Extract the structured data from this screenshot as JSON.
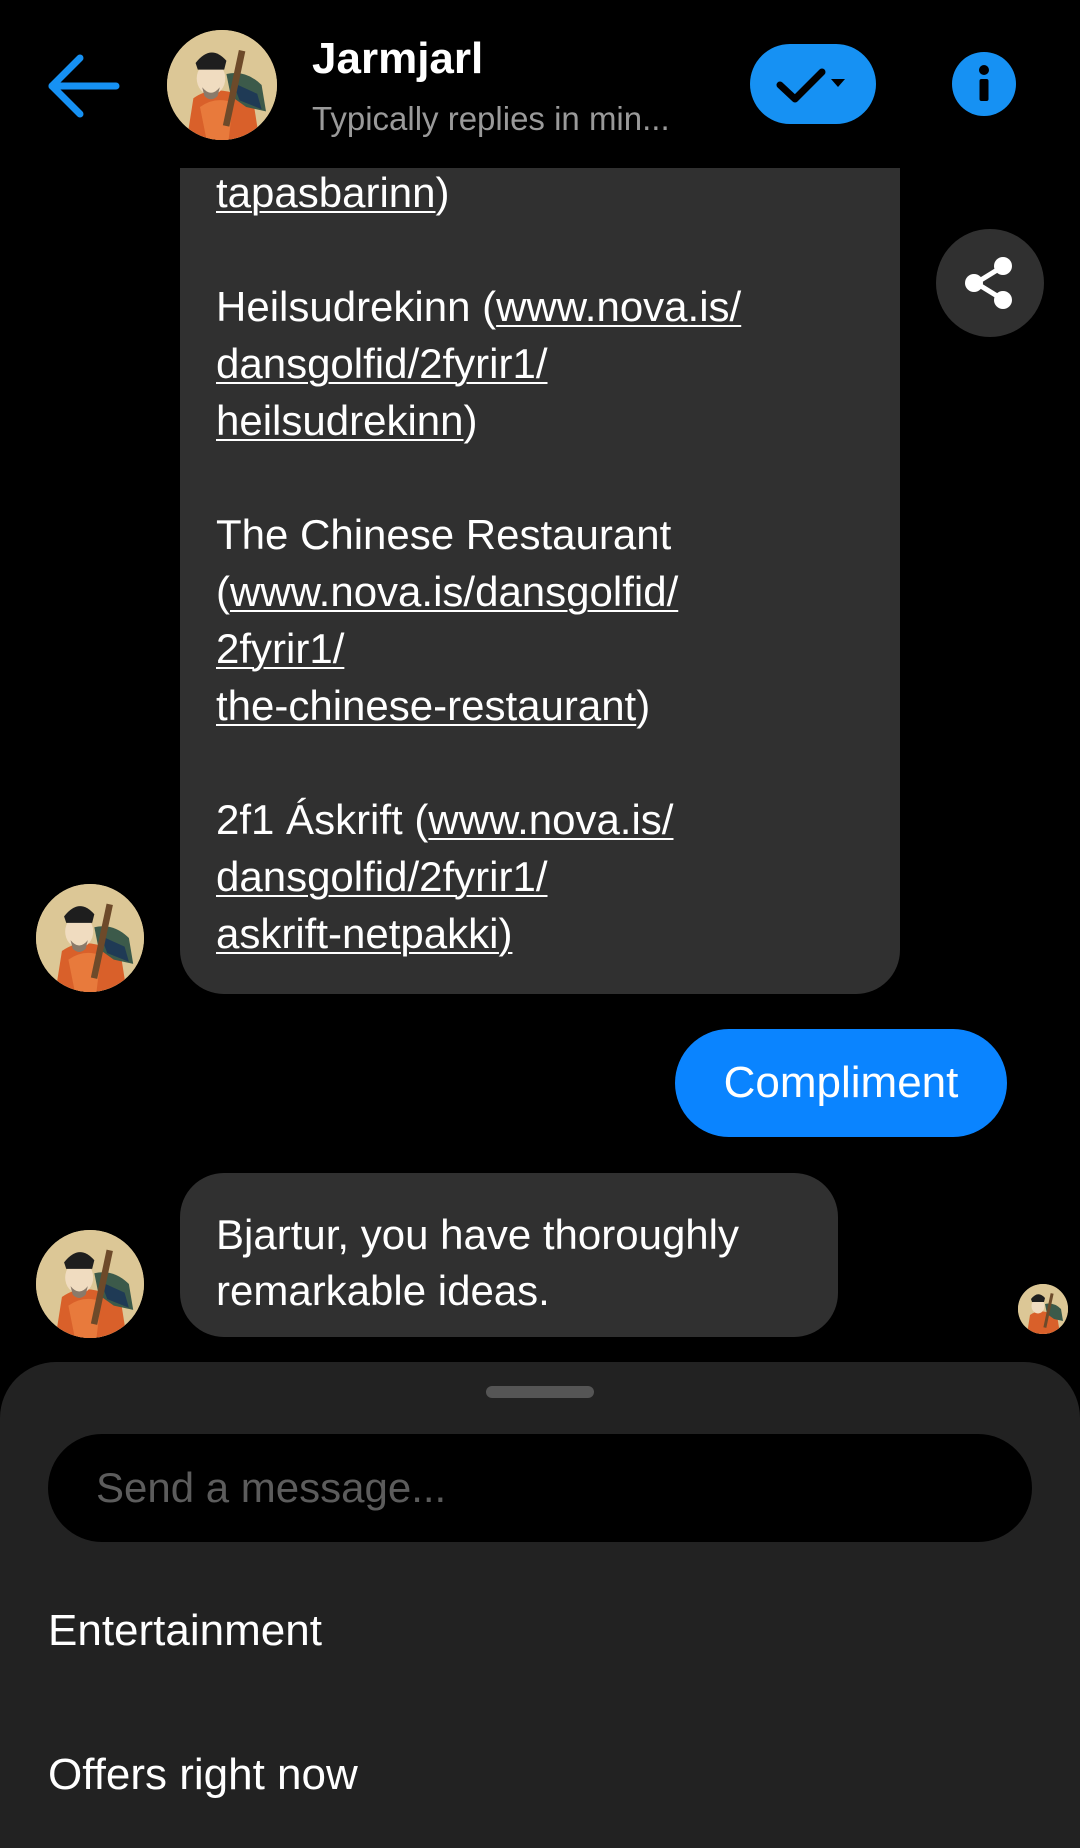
{
  "header": {
    "title": "Jarmjarl",
    "subtitle": "Typically replies in min..."
  },
  "colors": {
    "accent": "#1691f3",
    "user_bubble": "#0a84ff",
    "bot_bubble": "#303030",
    "sheet": "#222222"
  },
  "long_message": {
    "items": [
      {
        "name": "",
        "link": "tapasbarinn"
      },
      {
        "name": "Heilsudrekinn",
        "link_lines": [
          "www.nova.is/",
          "dansgolfid/2fyrir1/",
          "heilsudrekinn"
        ]
      },
      {
        "name": "The Chinese Restaurant",
        "link_lines": [
          "www.nova.is/dansgolfid/",
          "2fyrir1/",
          "the-chinese-restaurant"
        ]
      },
      {
        "name": "2f1 Áskrift",
        "link_lines": [
          "www.nova.is/",
          "dansgolfid/2fyrir1/",
          "askrift-netpakki"
        ]
      }
    ]
  },
  "user_message": "Compliment",
  "reply_message": {
    "line1": "Bjartur, you have thoroughly",
    "line2": "remarkable ideas."
  },
  "composer": {
    "placeholder": "Send a message..."
  },
  "quick_replies": [
    "Entertainment",
    "Offers right now"
  ]
}
